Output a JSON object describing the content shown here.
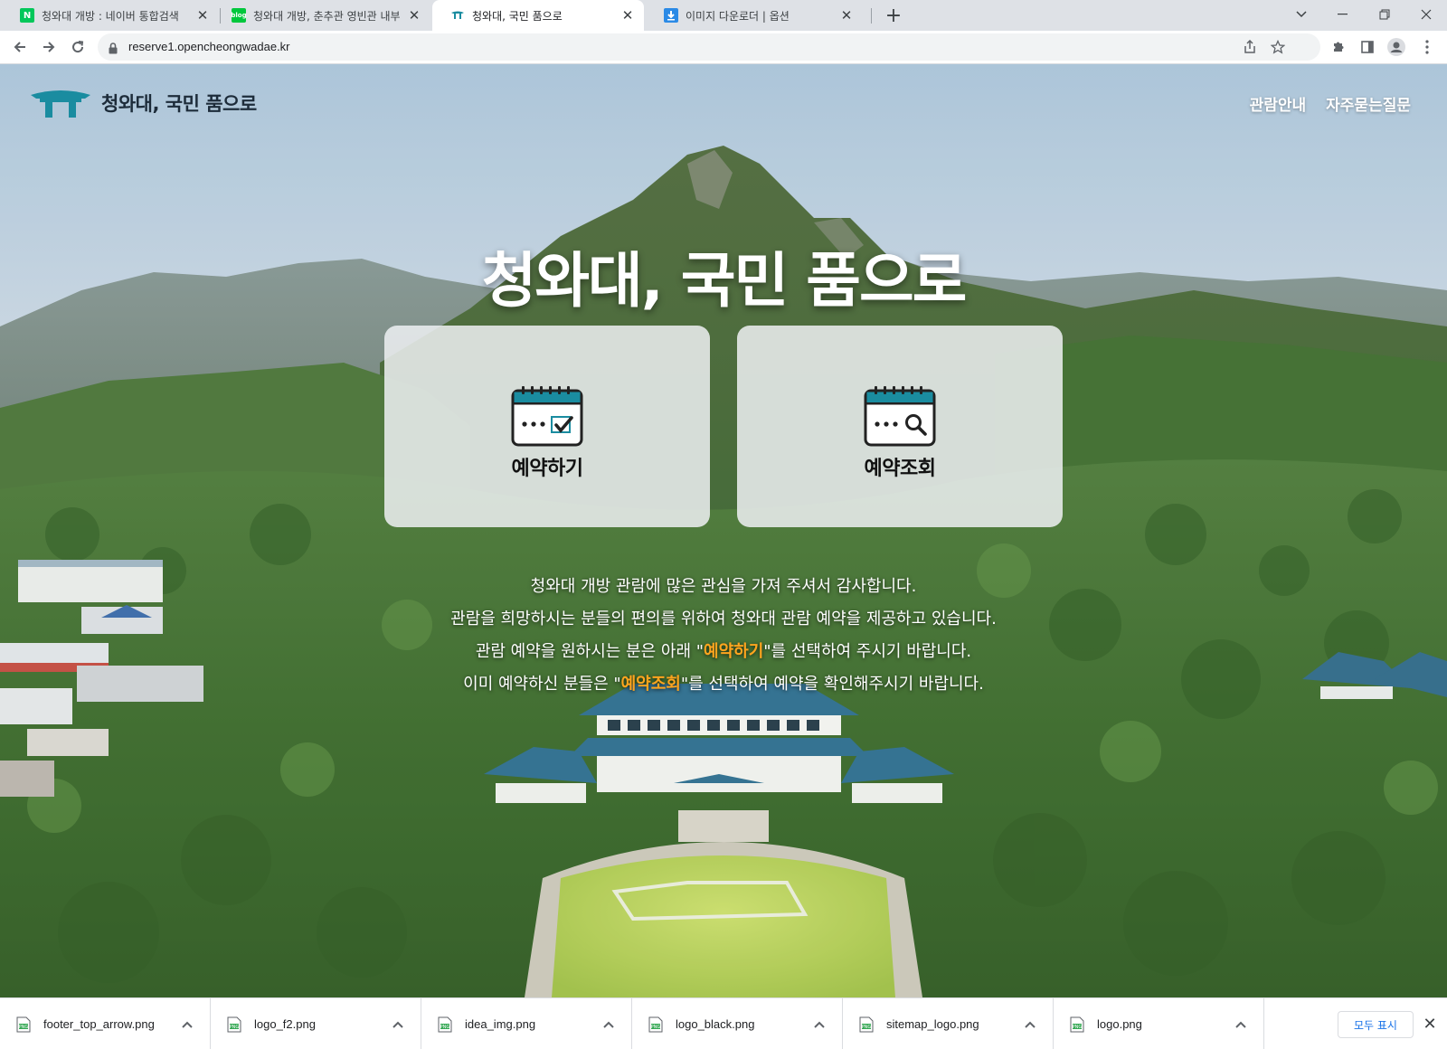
{
  "browser": {
    "tabs": [
      {
        "title": "청와대 개방 : 네이버 통합검색",
        "favicon": "naver-icon",
        "active": false
      },
      {
        "title": "청와대 개방, 춘추관 영빈관 내부",
        "favicon": "blog-icon",
        "active": false
      },
      {
        "title": "청와대, 국민 품으로",
        "favicon": "cheongwadae-icon",
        "active": true
      },
      {
        "title": "이미지 다운로더 | 옵션",
        "favicon": "downloader-icon",
        "active": false
      }
    ],
    "url": "reserve1.opencheongwadae.kr",
    "colors": {
      "accent": "#1a73e8",
      "naver": "#03c75a",
      "blog": "#00c73c",
      "downloader": "#2b8ae6"
    }
  },
  "site": {
    "logo_text": "청와대, 국민 품으로",
    "nav": [
      {
        "label": "관람안내"
      },
      {
        "label": "자주묻는질문"
      }
    ],
    "hero_title": "청와대, 국민 품으로",
    "cards": [
      {
        "label": "예약하기",
        "icon": "calendar-check-icon"
      },
      {
        "label": "예약조회",
        "icon": "calendar-search-icon"
      }
    ],
    "intro": {
      "line1": "청와대 개방 관람에 많은 관심을 가져 주셔서 감사합니다.",
      "line2": "관람을 희망하시는 분들의 편의를 위하여 청와대 관람 예약을 제공하고 있습니다.",
      "line3_before": "관람 예약을 원하시는 분은 아래 \"",
      "line3_highlight": "예약하기",
      "line3_after": "\"를 선택하여 주시기 바랍니다.",
      "line4_before": "이미 예약하신 분들은 \"",
      "line4_highlight": "예약조회",
      "line4_after": "\"를 선택하여 예약을 확인해주시기 바랍니다."
    },
    "colors": {
      "highlight": "#ffa51e",
      "brand": "#1a8ca0",
      "logo_text": "#1d2c3a"
    }
  },
  "downloads": {
    "items": [
      {
        "name": "footer_top_arrow.png"
      },
      {
        "name": "logo_f2.png"
      },
      {
        "name": "idea_img.png"
      },
      {
        "name": "logo_black.png"
      },
      {
        "name": "sitemap_logo.png"
      },
      {
        "name": "logo.png"
      }
    ],
    "show_all_label": "모두 표시"
  }
}
